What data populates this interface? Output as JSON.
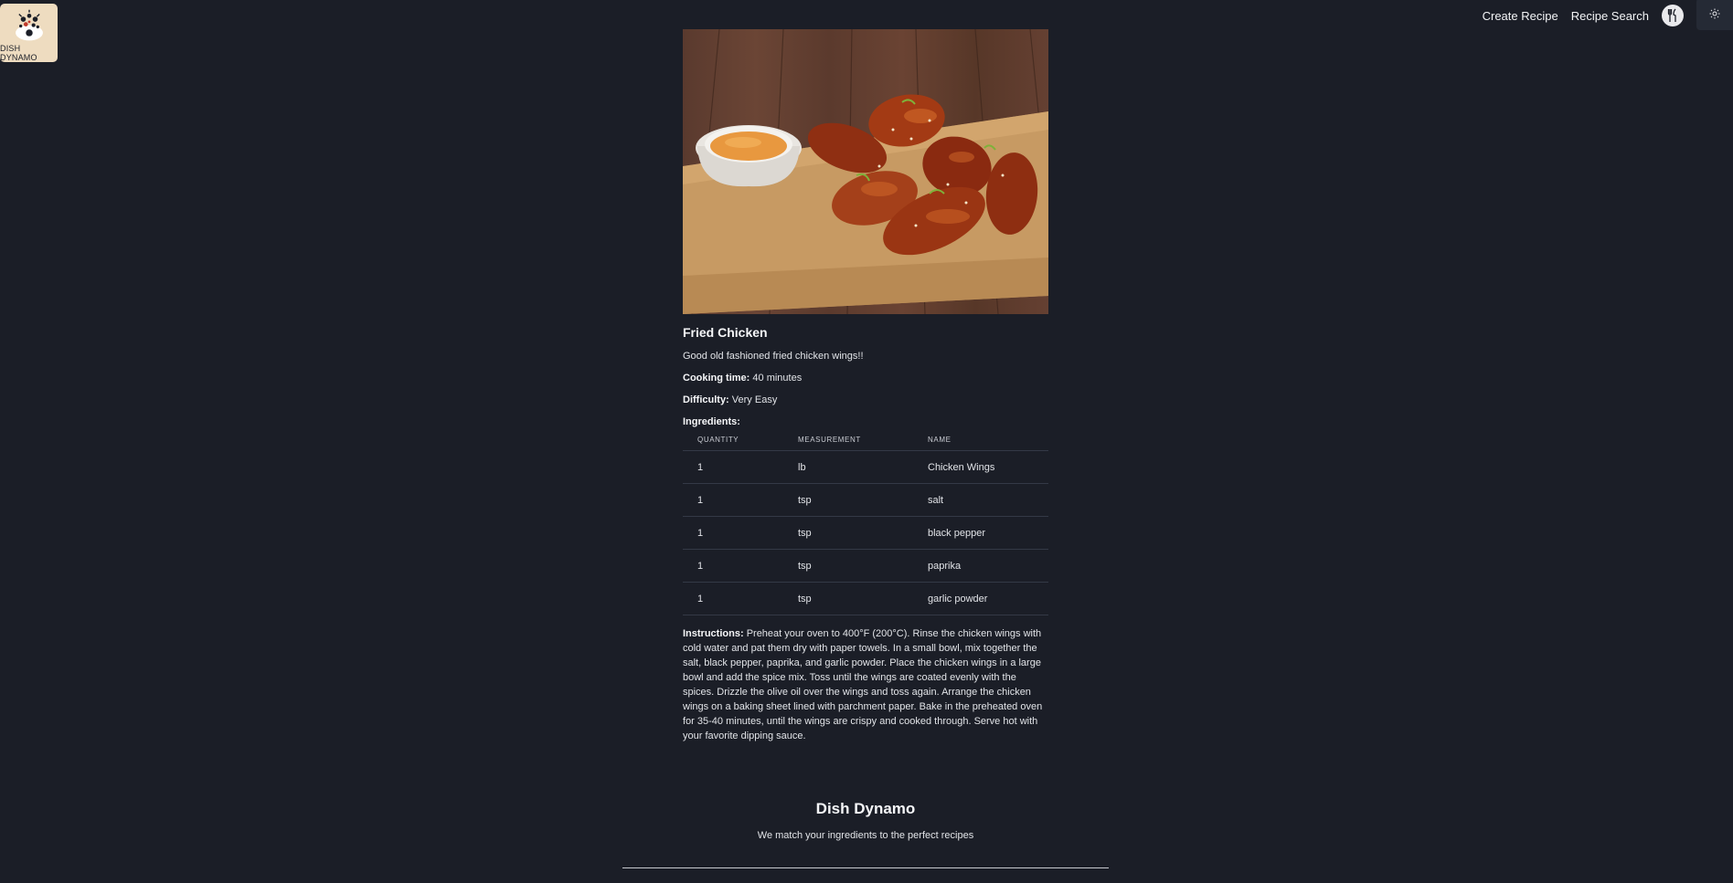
{
  "app": {
    "logo_text": "DISH DYNAMO"
  },
  "nav": {
    "create_recipe": "Create Recipe",
    "recipe_search": "Recipe Search",
    "icons": [
      "utensils-icon",
      "sun-icon"
    ]
  },
  "recipe": {
    "title": "Fried Chicken",
    "description": "Good old fashioned fried chicken wings!!",
    "cooking_time_label": "Cooking time:",
    "cooking_time_value": "40 minutes",
    "difficulty_label": "Difficulty:",
    "difficulty_value": "Very Easy",
    "ingredients_label": "Ingredients:",
    "ingredients_headers": [
      "QUANTITY",
      "MEASUREMENT",
      "NAME"
    ],
    "ingredients": [
      {
        "quantity": "1",
        "measurement": "lb",
        "name": "Chicken Wings"
      },
      {
        "quantity": "1",
        "measurement": "tsp",
        "name": "salt"
      },
      {
        "quantity": "1",
        "measurement": "tsp",
        "name": "black pepper"
      },
      {
        "quantity": "1",
        "measurement": "tsp",
        "name": "paprika"
      },
      {
        "quantity": "1",
        "measurement": "tsp",
        "name": "garlic powder"
      }
    ],
    "instructions_label": "Instructions:",
    "instructions_text": "Preheat your oven to 400°F (200°C). Rinse the chicken wings with cold water and pat them dry with paper towels. In a small bowl, mix together the salt, black pepper, paprika, and garlic powder. Place the chicken wings in a large bowl and add the spice mix. Toss until the wings are coated evenly with the spices. Drizzle the olive oil over the wings and toss again. Arrange the chicken wings on a baking sheet lined with parchment paper. Bake in the preheated oven for 35-40 minutes, until the wings are crispy and cooked through. Serve hot with your favorite dipping sauce."
  },
  "footer": {
    "title": "Dish Dynamo",
    "tagline": "We match your ingredients to the perfect recipes"
  },
  "colors": {
    "background": "#1b1e27",
    "text": "#e6e7ea",
    "logo_bg": "#eedcc0"
  }
}
